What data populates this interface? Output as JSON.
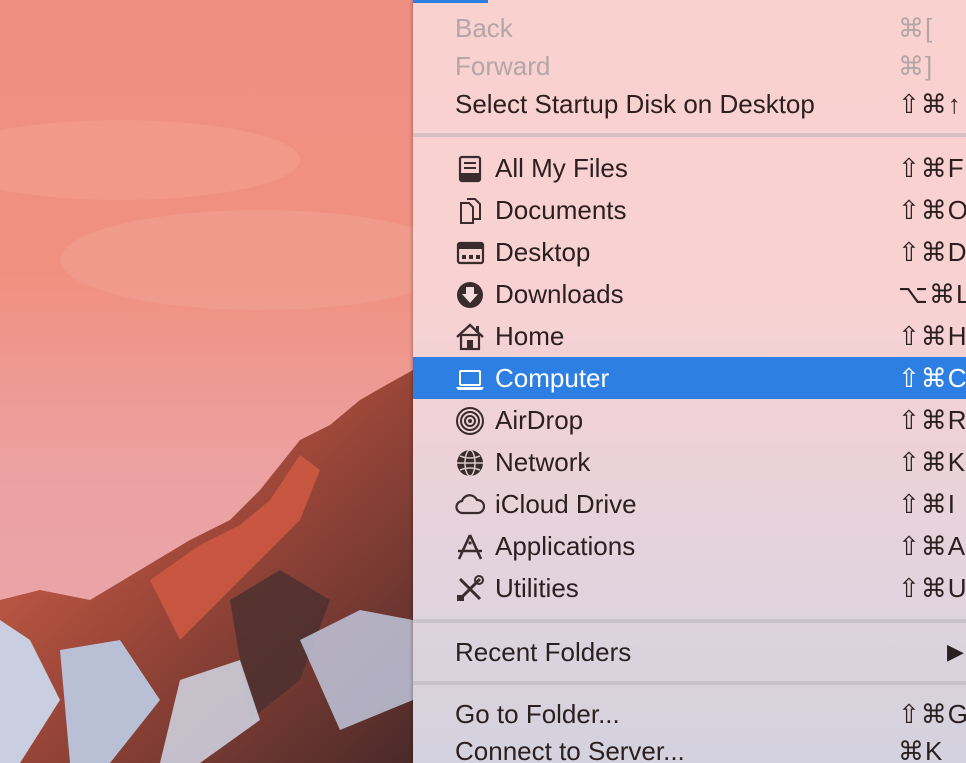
{
  "menu": {
    "section1": [
      {
        "label": "Back",
        "shortcut": "⌘[",
        "disabled": true
      },
      {
        "label": "Forward",
        "shortcut": "⌘]",
        "disabled": true
      },
      {
        "label": "Select Startup Disk on Desktop",
        "shortcut": "⇧⌘↑",
        "disabled": false
      }
    ],
    "section2": [
      {
        "label": "All My Files",
        "shortcut": "⇧⌘F",
        "icon": "all-files-icon"
      },
      {
        "label": "Documents",
        "shortcut": "⇧⌘O",
        "icon": "documents-icon"
      },
      {
        "label": "Desktop",
        "shortcut": "⇧⌘D",
        "icon": "desktop-icon"
      },
      {
        "label": "Downloads",
        "shortcut": "⌥⌘L",
        "icon": "downloads-icon"
      },
      {
        "label": "Home",
        "shortcut": "⇧⌘H",
        "icon": "home-icon"
      },
      {
        "label": "Computer",
        "shortcut": "⇧⌘C",
        "icon": "computer-icon",
        "selected": true
      },
      {
        "label": "AirDrop",
        "shortcut": "⇧⌘R",
        "icon": "airdrop-icon"
      },
      {
        "label": "Network",
        "shortcut": "⇧⌘K",
        "icon": "network-icon"
      },
      {
        "label": "iCloud Drive",
        "shortcut": "⇧⌘I",
        "icon": "icloud-icon"
      },
      {
        "label": "Applications",
        "shortcut": "⇧⌘A",
        "icon": "applications-icon"
      },
      {
        "label": "Utilities",
        "shortcut": "⇧⌘U",
        "icon": "utilities-icon"
      }
    ],
    "section3": [
      {
        "label": "Recent Folders",
        "submenu_arrow": "▶"
      }
    ],
    "section4": [
      {
        "label": "Go to Folder...",
        "shortcut": "⇧⌘G"
      },
      {
        "label": "Connect to Server...",
        "shortcut": "⌘K"
      }
    ]
  },
  "colors": {
    "selection": "#2e7fe3",
    "text": "#2b1f1f",
    "disabled_text": "#b4a6a8"
  }
}
